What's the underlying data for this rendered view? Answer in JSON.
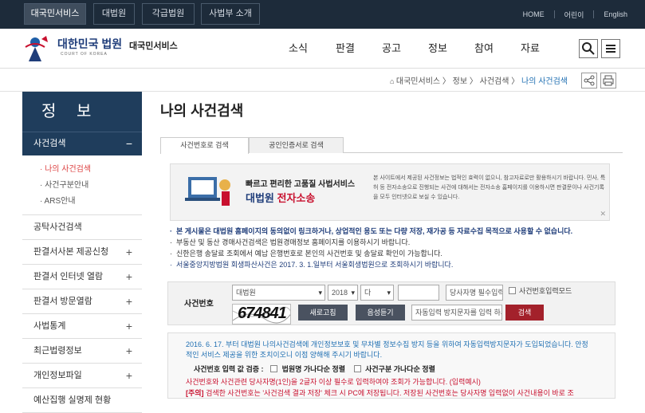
{
  "util": {
    "tabs": [
      "대국민서비스",
      "대법원",
      "각급법원",
      "사법부 소개"
    ],
    "links": [
      "HOME",
      "어린이",
      "English"
    ]
  },
  "logo": {
    "name": "대한민국 법원",
    "sub": "COURT OF KOREA",
    "service": "대국민서비스"
  },
  "gnb": {
    "menus": [
      "소식",
      "판결",
      "공고",
      "정보",
      "참여",
      "자료"
    ]
  },
  "breadcrumb": {
    "items": [
      "대국민서비스",
      "정보",
      "사건검색",
      "나의 사건검색"
    ]
  },
  "sidebar": {
    "title": "정 보",
    "selected": "사건검색",
    "selected_toggle": "−",
    "subitems": [
      "· 나의 사건검색",
      "· 사건구분안내",
      "· ARS안내"
    ],
    "items": [
      {
        "label": "공탁사건검색",
        "toggle": ""
      },
      {
        "label": "판결서사본 제공신청",
        "toggle": "+"
      },
      {
        "label": "판결서 인터넷 열람",
        "toggle": "+"
      },
      {
        "label": "판결서 방문열람",
        "toggle": "+"
      },
      {
        "label": "사법통계",
        "toggle": "+"
      },
      {
        "label": "최근법령정보",
        "toggle": "+"
      },
      {
        "label": "개인정보파일",
        "toggle": "+"
      },
      {
        "label": "예산집행 실명제 현황",
        "toggle": ""
      }
    ]
  },
  "main": {
    "title": "나의 사건검색",
    "tabs": [
      "사건번호로 검색",
      "공인인증서로 검색"
    ]
  },
  "banner": {
    "line1": "빠르고 편리한 고품질 사법서비스",
    "line2a": "대법원 ",
    "line2b": "전자소송",
    "desc": "본 사이트에서 제공된 사건정보는 법적인 효력이 없으니, 참고자료로만 활용하시기 바랍니다. 민사, 특허 등 전자소송으로 진행되는 사건에 대해서는 전자소송 홈페이지를 이용하시면 판결문이나 사건기록을 모두 인터넷으로 보실 수 있습니다."
  },
  "notices": [
    "본 게시물은 대법원 홈페이지의 동의없이 링크하거나, 상업적인 용도 또는 다량 저장, 재가공 등 자료수집 목적으로 사용할 수 없습니다.",
    "부동산 및 동산 경매사건검색은 법원경매정보 홈페이지를 이용하시기 바랍니다.",
    "신한은행 송달료 조회에서 예납 은행번호로 본인의 사건번호 및 송달료 확인이 가능합니다.",
    "서울중앙지방법원 회생파산사건은 2017. 3. 1.일부터 서울회생법원으로 조회하시기 바랍니다."
  ],
  "search": {
    "label": "사건번호",
    "court": "대법원",
    "year": "2018",
    "type": "다",
    "number_value": "",
    "party_placeholder": "당사자명 필수입력",
    "mode_label": "사건번호입력모드",
    "captcha_text": "674841",
    "refresh_label": "새로고침",
    "audio_label": "음성듣기",
    "captcha_placeholder": "자동입력 방지문자를 입력 하세요",
    "submit_label": "검색"
  },
  "info": {
    "line1": "2016. 6. 17. 부터 대법원 나의사건검색에 개인정보보호 및 무차별 정보수집 방지 등을 위하여 자동입력방지문자가 도입되었습니다. 안정적인 서비스 제공을 위한 조치이오니 이점 양해해 주시기 바랍니다.",
    "criteria_label": "사건번호 입력 값 검증 :",
    "check1": "법원명 가나다순 정렬",
    "check2": "사건구분 가나다순 정렬",
    "line2": "사건번호와 사건관련 당사자명(1인)을 2글자 이상 필수로 입력하여야 조회가 가능합니다. (입력예시)",
    "line3a": "[주의]",
    "line3b": "검색한 사건번호는 '사건검색 결과 저장' 체크 시 PC에 저장됩니다. 저장된 사건번호는 당사자명 입력없이 사건내용이 바로 조"
  },
  "colors": {
    "navy": "#1f3d5c",
    "dark": "#1d2b3a",
    "red": "#c8102e",
    "blue_link": "#1f6fb2",
    "search_btn": "#a3212b",
    "gray_btn": "#4a5260"
  }
}
